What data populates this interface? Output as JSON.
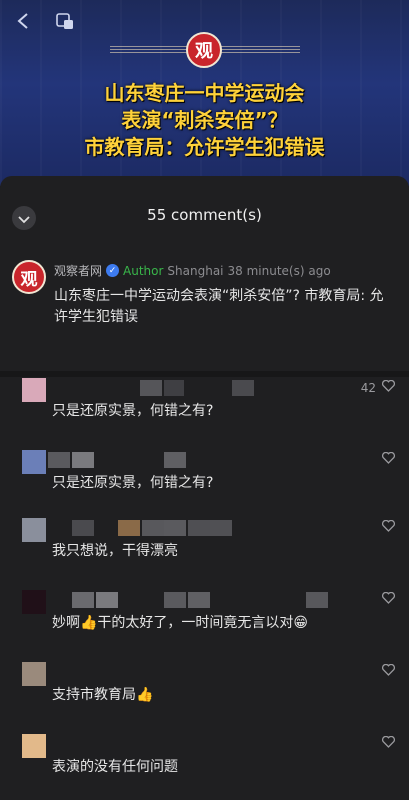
{
  "video": {
    "logo": "观",
    "headline": [
      "山东枣庄一中学运动会",
      "表演“刺杀安倍”？",
      "市教育局：允许学生犯错误"
    ]
  },
  "sheet": {
    "title": "55 comment(s)"
  },
  "author_post": {
    "avatar": "观",
    "name": "观察者网",
    "tag": "Author",
    "location": "Shanghai",
    "time": "38 minute(s) ago",
    "text": "山东枣庄一中学运动会表演“刺杀安倍”? 市教育局: 允许学生犯错误"
  },
  "comments": [
    {
      "text": "只是还原实景，何错之有?",
      "likes": "42",
      "avatar_color": "#d9a9b9"
    },
    {
      "text": "只是还原实景，何错之有?",
      "likes": "",
      "avatar_color": "#6b7fb8"
    },
    {
      "text": "我只想说，干得漂亮",
      "likes": "",
      "avatar_color": "#8a8f9c"
    },
    {
      "text": "妙啊👍干的太好了，一时间竟无言以对😁",
      "likes": "",
      "avatar_color": "#201018"
    },
    {
      "text": "支持市教育局👍",
      "likes": "",
      "avatar_color": "#9a8a7c"
    },
    {
      "text": "表演的没有任何问题",
      "likes": "",
      "avatar_color": "#e2b98a"
    }
  ],
  "icons": {
    "back": "back-icon",
    "pip": "picture-in-picture-icon",
    "collapse": "chevron-down-icon",
    "like": "heart-icon",
    "verified": "verified-icon"
  }
}
